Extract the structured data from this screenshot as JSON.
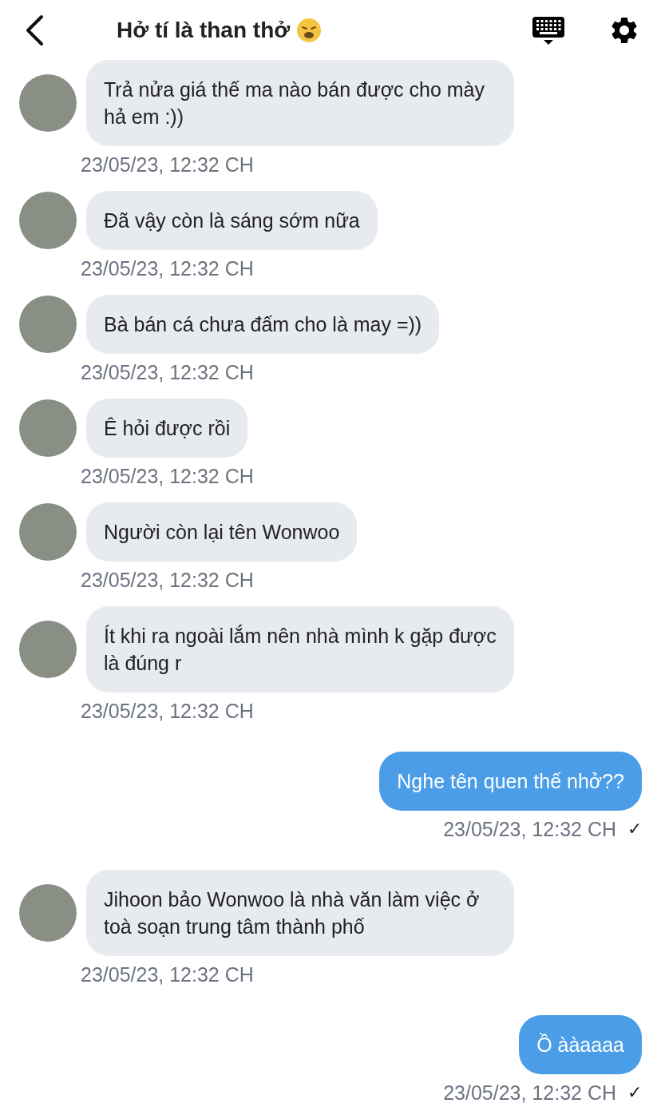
{
  "header": {
    "title": "Hở tí là than thở"
  },
  "messages": [
    {
      "kind": "received",
      "text": "Trả nửa giá thế ma nào bán được cho mày hả em :))",
      "time": "23/05/23, 12:32 CH"
    },
    {
      "kind": "received",
      "text": "Đã vậy còn là sáng sớm nữa",
      "time": "23/05/23, 12:32 CH"
    },
    {
      "kind": "received",
      "text": "Bà bán cá chưa đấm cho là may =))",
      "time": "23/05/23, 12:32 CH"
    },
    {
      "kind": "received",
      "text": "Ê hỏi được rồi",
      "time": "23/05/23, 12:32 CH"
    },
    {
      "kind": "received",
      "text": "Người còn lại tên Wonwoo",
      "time": "23/05/23, 12:32 CH"
    },
    {
      "kind": "received",
      "text": "Ít khi ra ngoài lắm nên nhà mình k gặp được là đúng r",
      "time": "23/05/23, 12:32 CH"
    },
    {
      "kind": "sent",
      "text": "Nghe tên quen thế nhở??",
      "time": "23/05/23, 12:32 CH",
      "status": "✓"
    },
    {
      "kind": "received",
      "text": "Jihoon bảo Wonwoo là nhà văn làm việc ở toà soạn trung tâm thành phố",
      "time": "23/05/23, 12:32 CH"
    },
    {
      "kind": "sent",
      "text": "Ồ ààaaaa",
      "time": "23/05/23, 12:32 CH",
      "status": "✓"
    }
  ]
}
